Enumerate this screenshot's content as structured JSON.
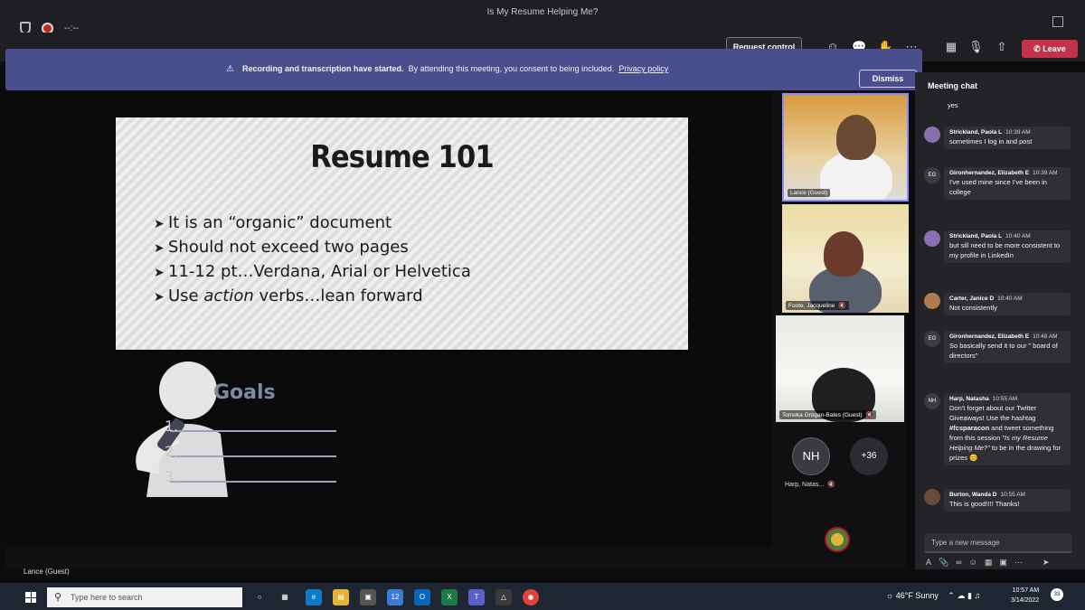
{
  "window": {
    "title": "Is My Resume Helping Me?",
    "timer": "--:--"
  },
  "toolbar": {
    "request_control": "Request control",
    "leave": "Leave",
    "icons": [
      "people-icon",
      "chat-icon",
      "reactions-icon",
      "more-icon",
      "camera-off-icon",
      "mic-off-icon",
      "share-icon"
    ]
  },
  "banner": {
    "bold": "Recording and transcription have started.",
    "text": "By attending this meeting, you consent to being included.",
    "link": "Privacy policy",
    "dismiss": "Dismiss"
  },
  "slide": {
    "title": "Resume 101",
    "bullets": [
      "It is an “organic” document",
      "Should not exceed two pages",
      "11-12 pt…Verdana, Arial or Helvetica",
      "Use action verbs…lean forward"
    ],
    "goals_title": "Goals",
    "goal_numbers": [
      "1.",
      "2.",
      "3."
    ]
  },
  "presenter": "Lance (Guest)",
  "participants": {
    "tile1": "Lance (Guest)",
    "tile2": "Foote, Jacqueline",
    "tile3": "Tomeka Grogan-Bates (Guest)",
    "avatar_initials": "NH",
    "avatar_name": "Harp, Natas...",
    "more_count": "+36"
  },
  "chat": {
    "title": "Meeting chat",
    "top_fragment": "yes",
    "messages": [
      {
        "author": "Strickland, Paola L",
        "time": "10:39 AM",
        "text": "sometimes I log in and post",
        "initials": "",
        "avatar_color": "#8a6fb0"
      },
      {
        "author": "Gironhernandez, Elizabeth E",
        "time": "10:39 AM",
        "text": "I've used mine since I've been in college",
        "initials": "EG",
        "avatar_color": "#3b3b44"
      },
      {
        "author": "Strickland, Paola L",
        "time": "10:40 AM",
        "text": "but sill need to be more consistent to my profile in LinkedIn",
        "initials": "",
        "avatar_color": "#8a6fb0"
      },
      {
        "author": "Carter, Janice D",
        "time": "10:40 AM",
        "text": "Not consistently",
        "initials": "",
        "avatar_color": "#b07a52"
      },
      {
        "author": "Gironhernandez, Elizabeth E",
        "time": "10:48 AM",
        "text": "So basically send it to our \" board of directors\"",
        "initials": "EG",
        "avatar_color": "#3b3b44"
      },
      {
        "author": "Harp, Natasha",
        "time": "10:55 AM",
        "text_parts": [
          "Don't forget about our Twitter Giveaways! Use the hashtag ",
          "#fcsparacon",
          " and tweet something from this session ",
          "\"Is my Resume Helping Me?\"",
          " to be in the drawing for prizes 😊"
        ],
        "initials": "NH",
        "avatar_color": "#3b3b44"
      },
      {
        "author": "Burton, Wanda D",
        "time": "10:55 AM",
        "text": "This is good!!!! Thanks!",
        "initials": "",
        "avatar_color": "#6a4a3a"
      }
    ],
    "input_placeholder": "Type a new message"
  },
  "taskbar": {
    "search_placeholder": "Type here to search",
    "weather": "46°F  Sunny",
    "time": "10:57 AM",
    "date": "3/14/2022",
    "notifications": "33",
    "mail_badge": "12"
  }
}
